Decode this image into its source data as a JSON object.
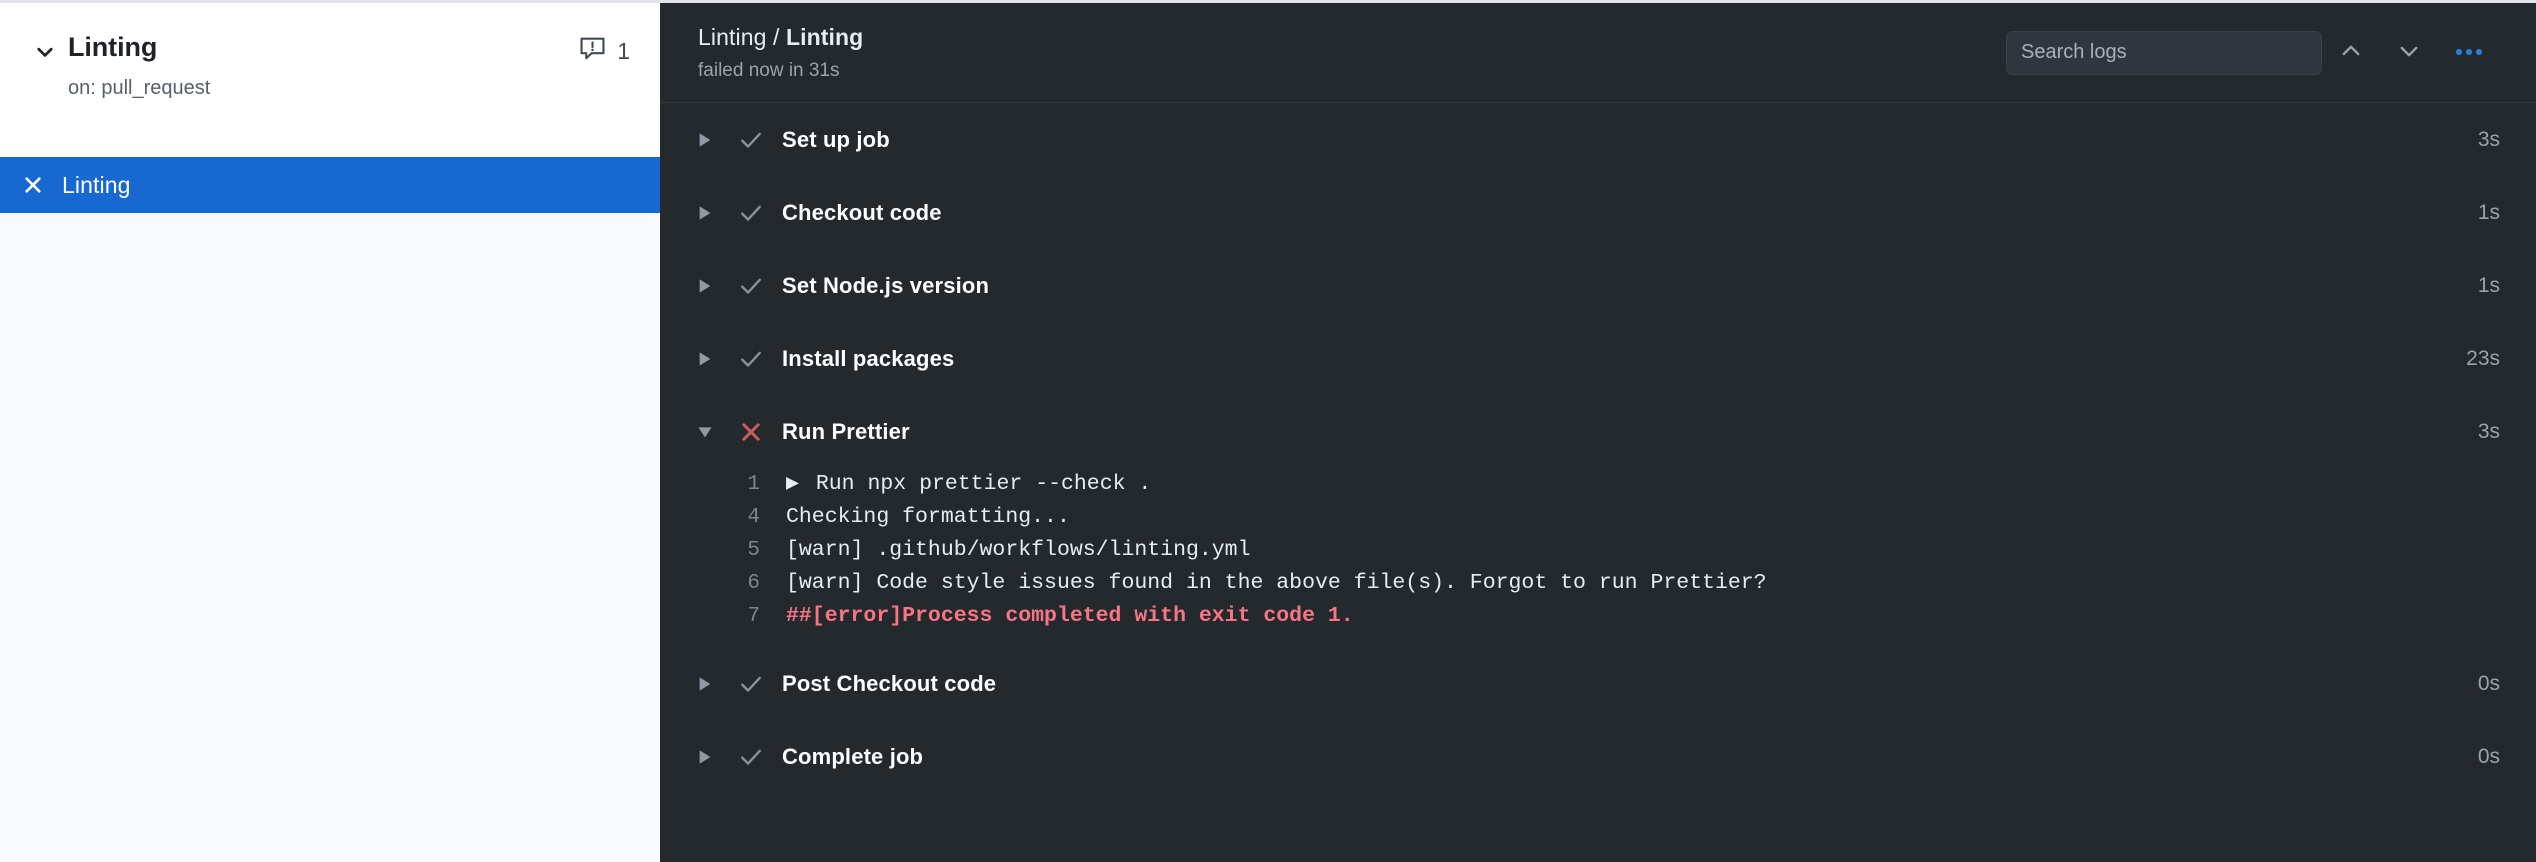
{
  "sidebar": {
    "workflow": {
      "chevron_icon": "chevron-down-icon",
      "title": "Linting",
      "trigger": "on: pull_request",
      "annotation_icon": "alert-comment-icon",
      "annotation_count": "1"
    },
    "job": {
      "status_icon": "x-icon",
      "name": "Linting",
      "selected_color": "#1768d1"
    }
  },
  "main": {
    "header": {
      "title_prefix": "Linting",
      "title_separator": " / ",
      "title_name": "Linting",
      "status_line": "failed now in 31s",
      "search": {
        "placeholder": "Search logs",
        "value": ""
      },
      "prev_icon": "chevron-up-icon",
      "next_icon": "chevron-down-icon",
      "menu_icon": "kebab-horizontal-icon",
      "menu_color": "#2b7cd3"
    },
    "steps": [
      {
        "caret_icon": "triangle-right-icon",
        "status": "success",
        "status_icon": "check-icon",
        "label": "Set up job",
        "duration": "3s",
        "expanded": false
      },
      {
        "caret_icon": "triangle-right-icon",
        "status": "success",
        "status_icon": "check-icon",
        "label": "Checkout code",
        "duration": "1s",
        "expanded": false
      },
      {
        "caret_icon": "triangle-right-icon",
        "status": "success",
        "status_icon": "check-icon",
        "label": "Set Node.js version",
        "duration": "1s",
        "expanded": false
      },
      {
        "caret_icon": "triangle-right-icon",
        "status": "success",
        "status_icon": "check-icon",
        "label": "Install packages",
        "duration": "23s",
        "expanded": false
      },
      {
        "caret_icon": "triangle-down-icon",
        "status": "failure",
        "status_icon": "x-icon",
        "label": "Run Prettier",
        "duration": "3s",
        "expanded": true
      },
      {
        "caret_icon": "triangle-right-icon",
        "status": "success",
        "status_icon": "check-icon",
        "label": "Post Checkout code",
        "duration": "0s",
        "expanded": false
      },
      {
        "caret_icon": "triangle-right-icon",
        "status": "success",
        "status_icon": "check-icon",
        "label": "Complete job",
        "duration": "0s",
        "expanded": false
      }
    ],
    "log": [
      {
        "num": "1",
        "marker": "▶ ",
        "text": "Run npx prettier --check .",
        "error": false
      },
      {
        "num": "4",
        "marker": "",
        "text": "Checking formatting...",
        "error": false
      },
      {
        "num": "5",
        "marker": "",
        "text": "[warn] .github/workflows/linting.yml",
        "error": false
      },
      {
        "num": "6",
        "marker": "",
        "text": "[warn] Code style issues found in the above file(s). Forgot to run Prettier?",
        "error": false
      },
      {
        "num": "7",
        "marker": "",
        "text": "##[error]Process completed with exit code 1.",
        "error": true
      }
    ]
  },
  "colors": {
    "panel_bg": "#24292e",
    "sidebar_bg": "#f8f9fb",
    "accent_blue": "#1768d1",
    "error_red": "#f97583",
    "fail_x": "#cf5a5a"
  }
}
